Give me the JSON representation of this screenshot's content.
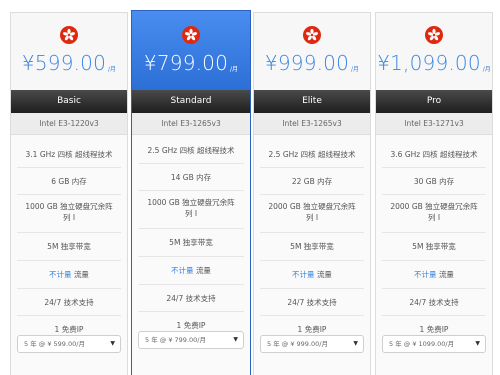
{
  "plans": [
    {
      "price": "¥599.00",
      "unit": "/月",
      "name": "Basic",
      "cpu": "Intel E3-1220v3",
      "features": [
        "3.1 GHz 四核 超线程技术",
        "6 GB 内存",
        "1000 GB 独立硬盘冗余阵列 I",
        "5M 独享带宽",
        "流量",
        "24/7 技术支持",
        "1 免费IP"
      ],
      "traffic_label": "不计量",
      "option": "5 年 @ ¥ 599.00/月"
    },
    {
      "price": "¥799.00",
      "unit": "/月",
      "name": "Standard",
      "cpu": "Intel E3-1265v3",
      "features": [
        "2.5 GHz 四核 超线程技术",
        "14 GB 内存",
        "1000 GB 独立硬盘冗余阵列 I",
        "5M 独享带宽",
        "流量",
        "24/7 技术支持",
        "1 免费IP"
      ],
      "traffic_label": "不计量",
      "option": "5 年 @ ¥ 799.00/月"
    },
    {
      "price": "¥999.00",
      "unit": "/月",
      "name": "Elite",
      "cpu": "Intel E3-1265v3",
      "features": [
        "2.5 GHz 四核 超线程技术",
        "22 GB 内存",
        "2000 GB 独立硬盘冗余阵列 I",
        "5M 独享带宽",
        "流量",
        "24/7 技术支持",
        "1 免费IP"
      ],
      "traffic_label": "不计量",
      "option": "5 年 @ ¥ 999.00/月"
    },
    {
      "price": "¥1,099.00",
      "unit": "/月",
      "name": "Pro",
      "cpu": "Intel E3-1271v3",
      "features": [
        "3.6 GHz 四核 超线程技术",
        "30 GB 内存",
        "2000 GB 独立硬盘冗余阵列 I",
        "5M 独享带宽",
        "流量",
        "24/7 技术支持",
        "1 免费IP"
      ],
      "traffic_label": "不计量",
      "option": "5 年 @ ¥ 1099.00/月"
    }
  ],
  "featured_index": 1,
  "colors": {
    "accent": "#3a86e0",
    "featured_bg": "#2c6fd6",
    "bar_bg": "#2a2a2a",
    "flag_red": "#de2910"
  }
}
